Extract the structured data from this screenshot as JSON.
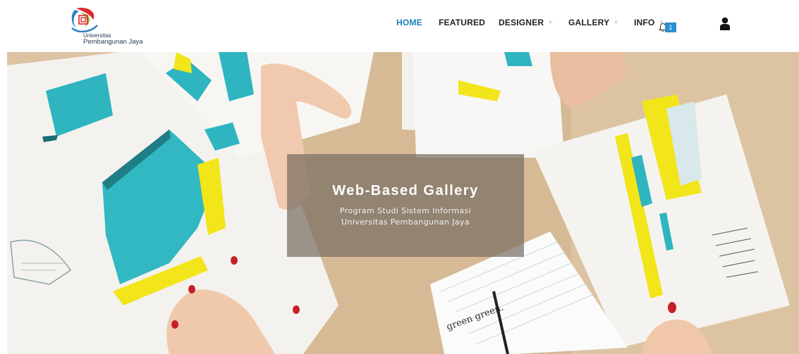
{
  "brand": {
    "line1": "Universitas",
    "line2": "Pembangunan Jaya"
  },
  "nav": {
    "home": "HOME",
    "featured": "FEATURED",
    "designer": "DESIGNER",
    "gallery": "GALLERY",
    "info": "INFO",
    "plus": "+",
    "notification_count": "1",
    "bell_icon": "bell-icon",
    "user_icon": "user-icon",
    "active_color": "#1a7fb5",
    "badge_color": "#2b8fd0"
  },
  "hero": {
    "title": "Web-Based Gallery",
    "subtitle_line1": "Program Studi Sistem Informasi",
    "subtitle_line2": "Universitas Pembangunan Jaya",
    "handwriting": "green green."
  }
}
